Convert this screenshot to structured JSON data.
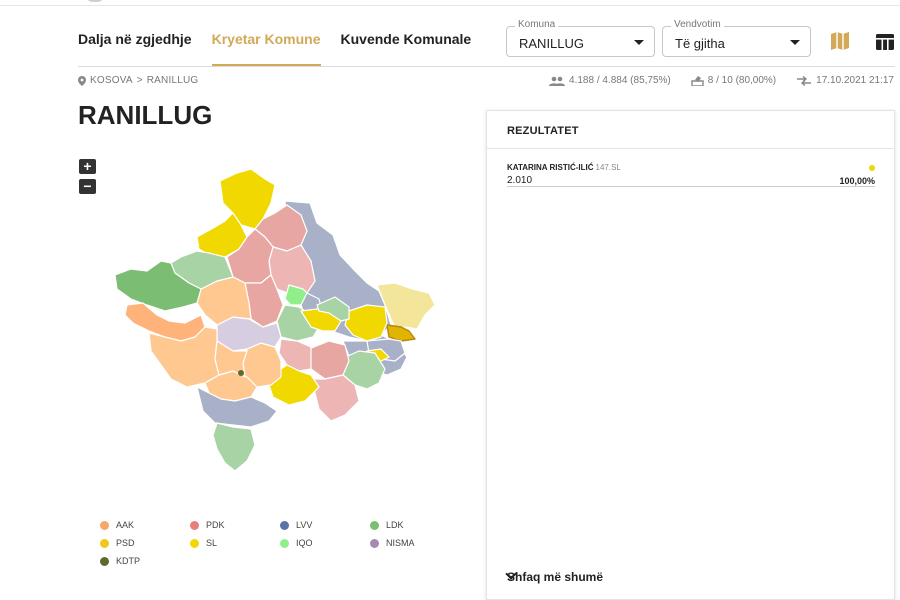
{
  "nav": {
    "tabs": [
      {
        "label": "Dalja në zgjedhje",
        "active": false
      },
      {
        "label": "Kryetar Komune",
        "active": true
      },
      {
        "label": "Kuvende Komunale",
        "active": false
      }
    ]
  },
  "filters": {
    "komuna_label": "Komuna",
    "komuna_value": "RANILLUG",
    "vendvotim_label": "Vendvotim",
    "vendvotim_value": "Të gjitha"
  },
  "breadcrumb": {
    "items": [
      "KOSOVA",
      "RANILLUG"
    ],
    "separator": ">"
  },
  "stats": {
    "turnout": "4.188 / 4.884 (85,75%)",
    "stations": "8 / 10 (80,00%)",
    "updated": "17.10.2021 21:17"
  },
  "page_title": "RANILLUG",
  "zoom": {
    "in": "+",
    "out": "−"
  },
  "legend": [
    {
      "label": "AAK",
      "color": "#f5a868"
    },
    {
      "label": "PDK",
      "color": "#e87e7e"
    },
    {
      "label": "LVV",
      "color": "#5b73a8"
    },
    {
      "label": "LDK",
      "color": "#7bbd73"
    },
    {
      "label": "PSD",
      "color": "#f0c71c"
    },
    {
      "label": "SL",
      "color": "#f0d800"
    },
    {
      "label": "IQO",
      "color": "#8ff08a"
    },
    {
      "label": "NISMA",
      "color": "#a48bb2"
    },
    {
      "label": "KDTP",
      "color": "#5f6a2c"
    }
  ],
  "results": {
    "heading": "REZULTATET",
    "candidates": [
      {
        "name": "KATARINA RISTIĆ-ILIĆ",
        "party": "147.SL",
        "votes": "2.010",
        "percent": "100,00%",
        "color": "#f0d800"
      }
    ],
    "show_more": "Shfaq më shumë"
  },
  "colors": {
    "accent": "#d2a957"
  }
}
